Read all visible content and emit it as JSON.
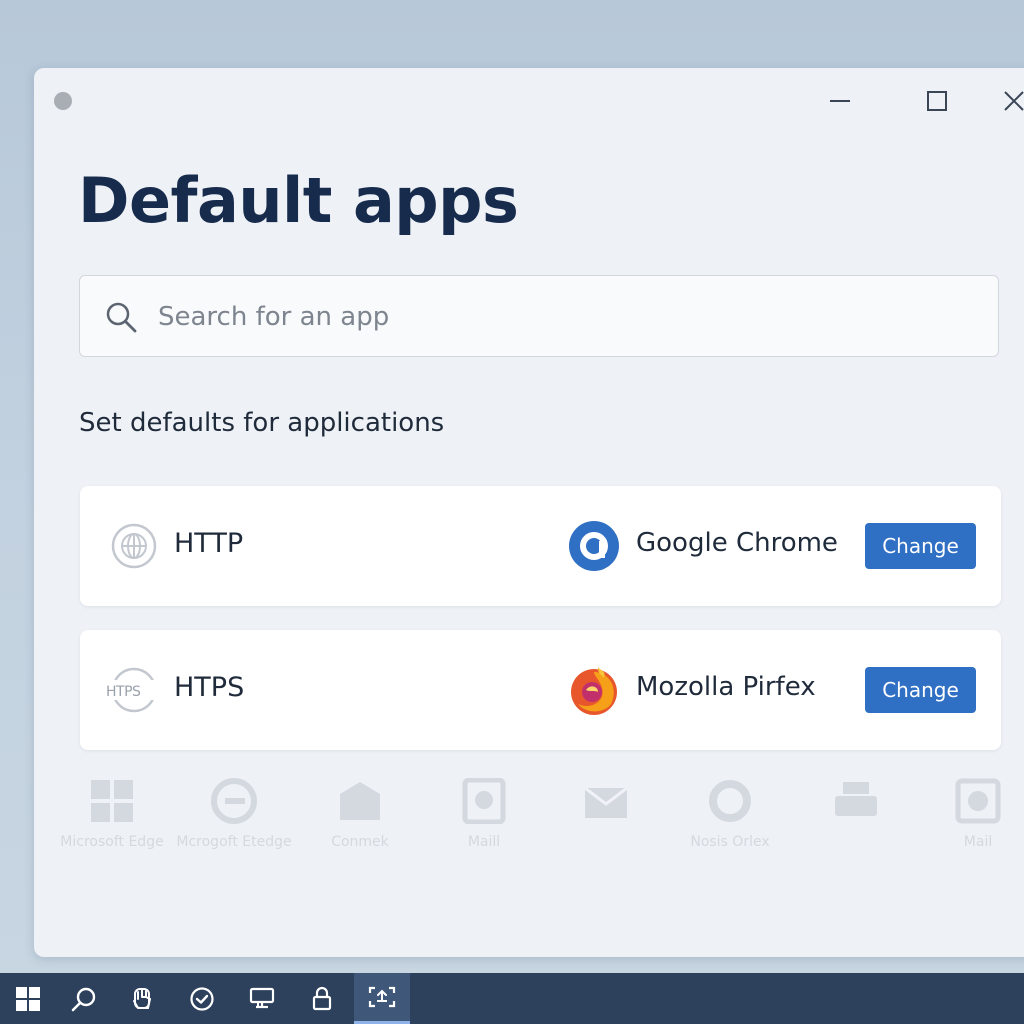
{
  "page": {
    "title": "Default apps",
    "section_heading": "Set defaults for applications"
  },
  "search": {
    "placeholder": "Search for an app",
    "value": "",
    "icon": "search-icon"
  },
  "window_controls": {
    "minimize_icon": "minimize-icon",
    "maximize_icon": "maximize-icon",
    "close_icon": "close-icon"
  },
  "rows": [
    {
      "protocol": "HTTP",
      "protocol_icon": "globe-icon",
      "app_name": "Google Chrome",
      "app_icon": "chrome-icon",
      "button_label": "Change"
    },
    {
      "protocol": "HTPS",
      "protocol_icon_text": "HTPS",
      "protocol_icon": "https-icon",
      "app_name": "Mozolla Pirfex",
      "app_icon": "firefox-icon",
      "button_label": "Change"
    }
  ],
  "faded_apps": [
    {
      "label": "Microsoft Edge",
      "icon": "grid-icon"
    },
    {
      "label": "Mcrogoft Etedge",
      "icon": "edge-icon"
    },
    {
      "label": "Conmek",
      "icon": "envelope-icon"
    },
    {
      "label": "Maill",
      "icon": "document-icon"
    },
    {
      "label": "",
      "icon": "mail-icon"
    },
    {
      "label": "Nosis Orlex",
      "icon": "circle-icon"
    },
    {
      "label": "",
      "icon": "printer-icon"
    },
    {
      "label": "Mail",
      "icon": "photo-icon"
    }
  ],
  "taskbar": {
    "items": [
      {
        "icon": "windows-start-icon"
      },
      {
        "icon": "search-icon"
      },
      {
        "icon": "hand-icon"
      },
      {
        "icon": "check-circle-icon"
      },
      {
        "icon": "monitor-icon"
      },
      {
        "icon": "lock-icon"
      },
      {
        "icon": "screenshot-icon",
        "active": true
      }
    ]
  },
  "colors": {
    "title": "#172b4d",
    "accent": "#2f6fc4",
    "taskbar": "#2d415c",
    "window_bg": "#eef1f6",
    "desktop_bg": "#b7c8d9"
  }
}
